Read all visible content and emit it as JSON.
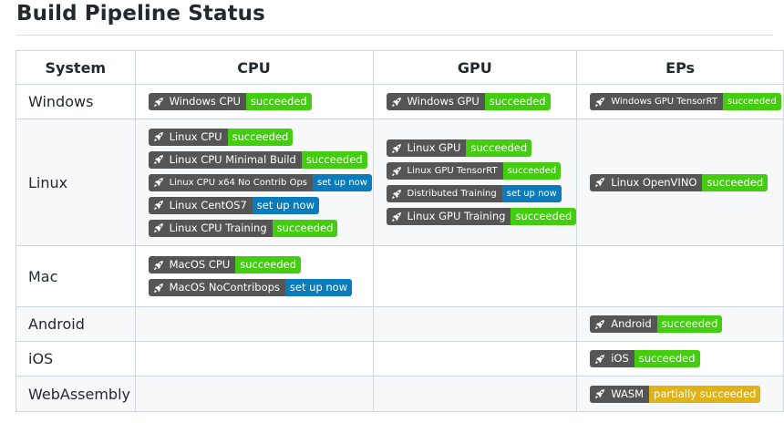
{
  "page": {
    "title": "Build Pipeline Status"
  },
  "colors": {
    "succeeded": "#44cc11",
    "set_up_now": "#0a7bbb",
    "partially_succeeded": "#dfb317",
    "badge_left": "#555555"
  },
  "icons": {
    "badge_icon": "rocket-icon"
  },
  "table": {
    "headers": [
      "System",
      "CPU",
      "GPU",
      "EPs"
    ],
    "rows": [
      {
        "system": "Windows",
        "cpu": [
          {
            "label": "Windows CPU",
            "status": "succeeded"
          }
        ],
        "gpu": [
          {
            "label": "Windows GPU",
            "status": "succeeded"
          }
        ],
        "eps": [
          {
            "label": "Windows GPU TensorRT",
            "status": "succeeded"
          }
        ]
      },
      {
        "system": "Linux",
        "cpu": [
          {
            "label": "Linux CPU",
            "status": "succeeded"
          },
          {
            "label": "Linux CPU Minimal Build",
            "status": "succeeded"
          },
          {
            "label": "Linux CPU x64 No Contrib Ops",
            "status": "set up now"
          },
          {
            "label": "Linux CentOS7",
            "status": "set up now"
          },
          {
            "label": "Linux CPU Training",
            "status": "succeeded"
          }
        ],
        "gpu": [
          {
            "label": "Linux GPU",
            "status": "succeeded"
          },
          {
            "label": "Linux GPU TensorRT",
            "status": "succeeded"
          },
          {
            "label": "Distributed Training",
            "status": "set up now"
          },
          {
            "label": "Linux GPU Training",
            "status": "succeeded"
          }
        ],
        "eps": [
          {
            "label": "Linux OpenVINO",
            "status": "succeeded"
          }
        ]
      },
      {
        "system": "Mac",
        "cpu": [
          {
            "label": "MacOS CPU",
            "status": "succeeded"
          },
          {
            "label": "MacOS NoContribops",
            "status": "set up now"
          }
        ],
        "gpu": [],
        "eps": []
      },
      {
        "system": "Android",
        "cpu": [],
        "gpu": [],
        "eps": [
          {
            "label": "Android",
            "status": "succeeded"
          }
        ]
      },
      {
        "system": "iOS",
        "cpu": [],
        "gpu": [],
        "eps": [
          {
            "label": "iOS",
            "status": "succeeded"
          }
        ]
      },
      {
        "system": "WebAssembly",
        "cpu": [],
        "gpu": [],
        "eps": [
          {
            "label": "WASM",
            "status": "partially succeeded"
          }
        ]
      }
    ]
  }
}
